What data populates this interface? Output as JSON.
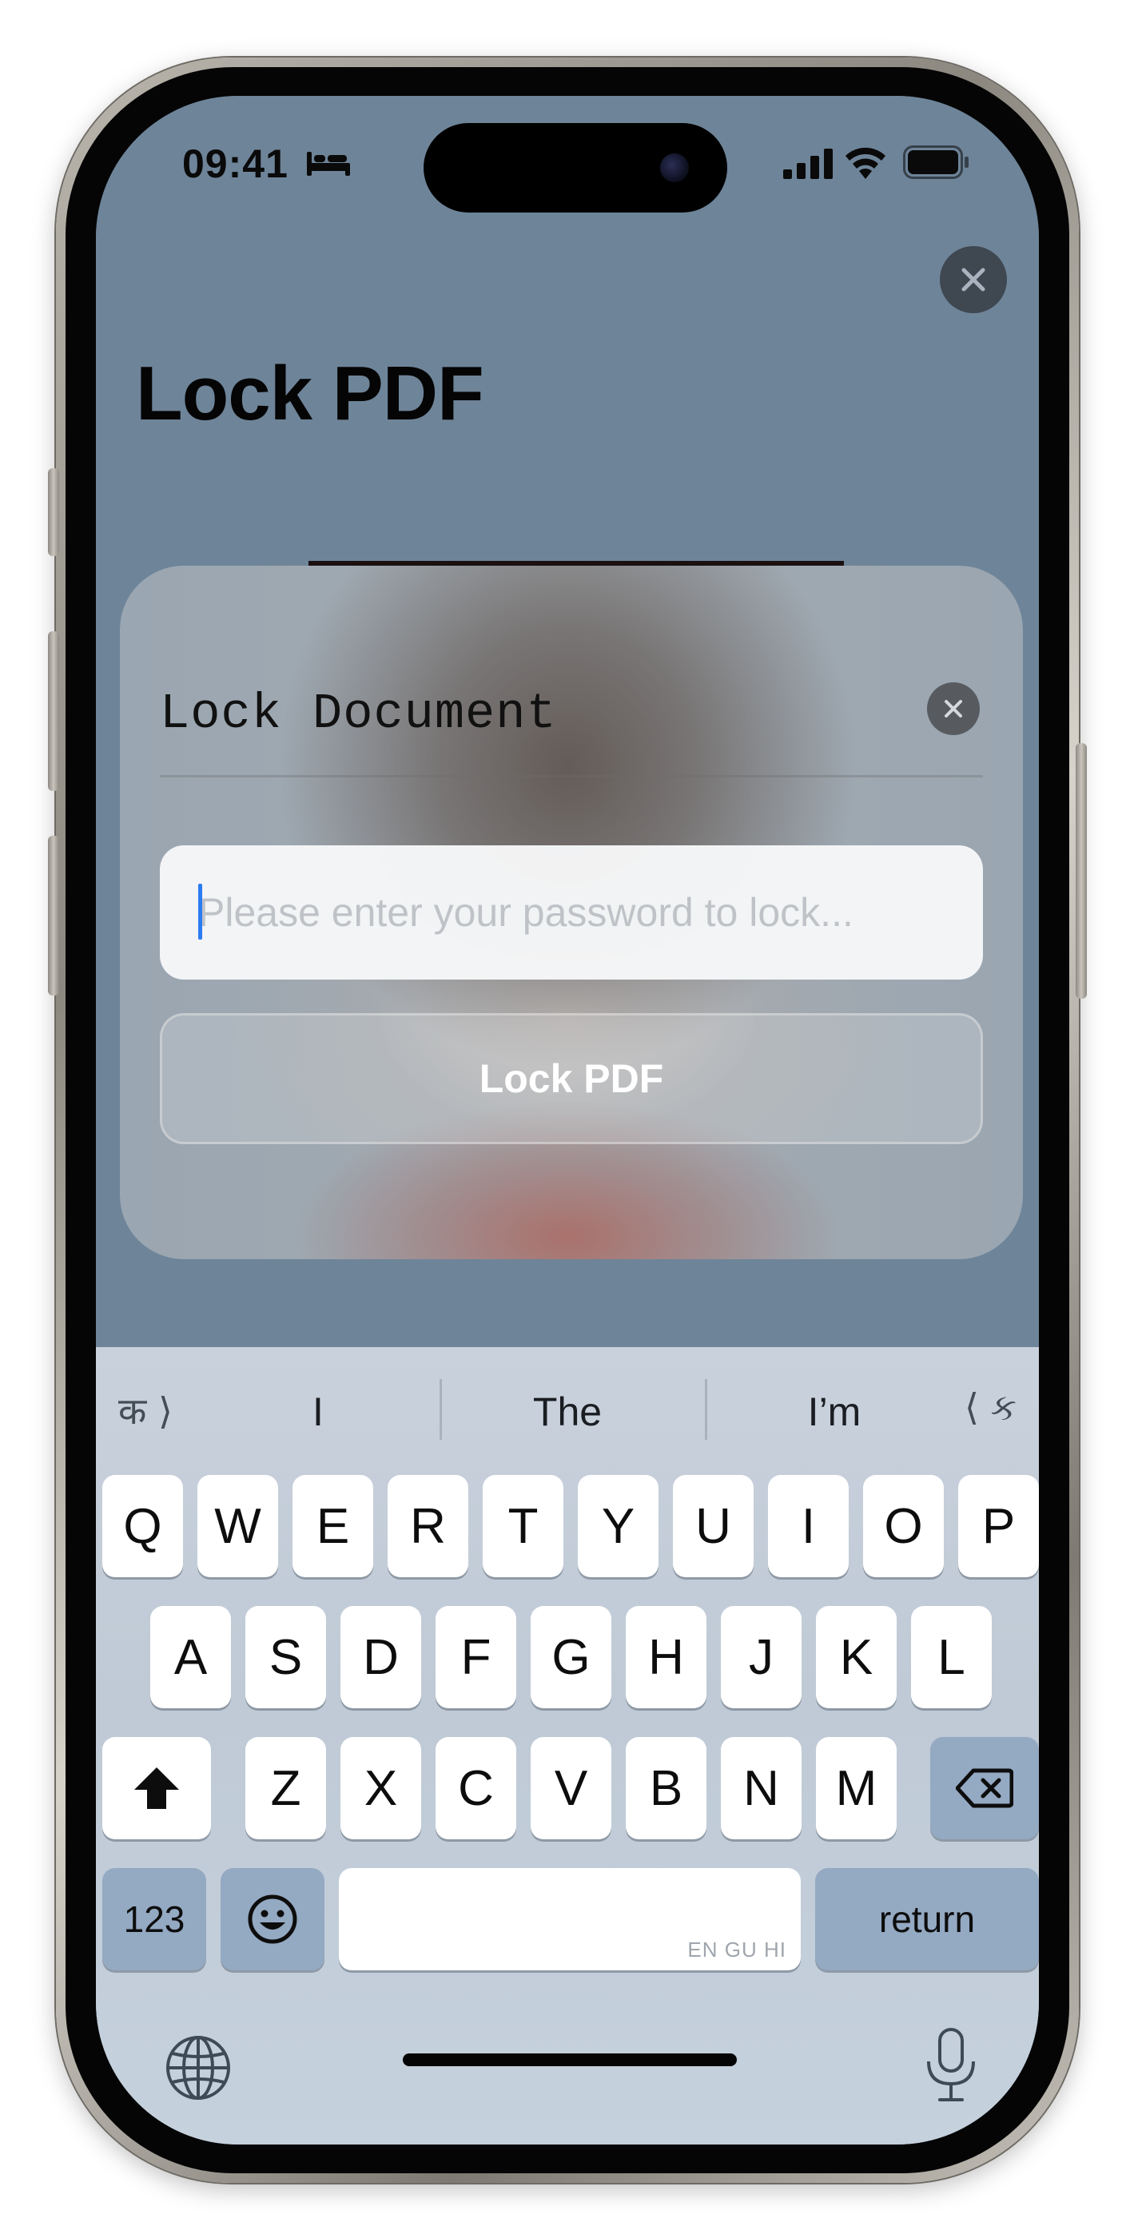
{
  "status_bar": {
    "time": "09:41"
  },
  "header": {
    "title": "Lock PDF"
  },
  "modal": {
    "title": "Lock Document",
    "password_placeholder": "Please enter your password to lock...",
    "password_value": "",
    "submit_label": "Lock PDF"
  },
  "keyboard": {
    "suggestions": {
      "lang_left": "क ⟩",
      "lang_right": "⟨ ક",
      "items": [
        "I",
        "The",
        "I’m"
      ]
    },
    "rows": [
      [
        "Q",
        "W",
        "E",
        "R",
        "T",
        "Y",
        "U",
        "I",
        "O",
        "P"
      ],
      [
        "A",
        "S",
        "D",
        "F",
        "G",
        "H",
        "J",
        "K",
        "L"
      ],
      [
        "Z",
        "X",
        "C",
        "V",
        "B",
        "N",
        "M"
      ]
    ],
    "numbers_label": "123",
    "return_label": "return",
    "space_languages": "EN GU HI"
  },
  "icons": {
    "status": [
      "bed-icon",
      "signal-icon",
      "wifi-icon",
      "battery-icon"
    ],
    "controls": [
      "close-icon",
      "shift-icon",
      "delete-icon",
      "emoji-icon",
      "globe-icon",
      "microphone-icon"
    ]
  },
  "colors": {
    "accent_caret": "#2b7bf2",
    "dim_background": "#6e8499",
    "keyboard_background": "#c5d1dd",
    "dark_key": "#94a9c2"
  }
}
